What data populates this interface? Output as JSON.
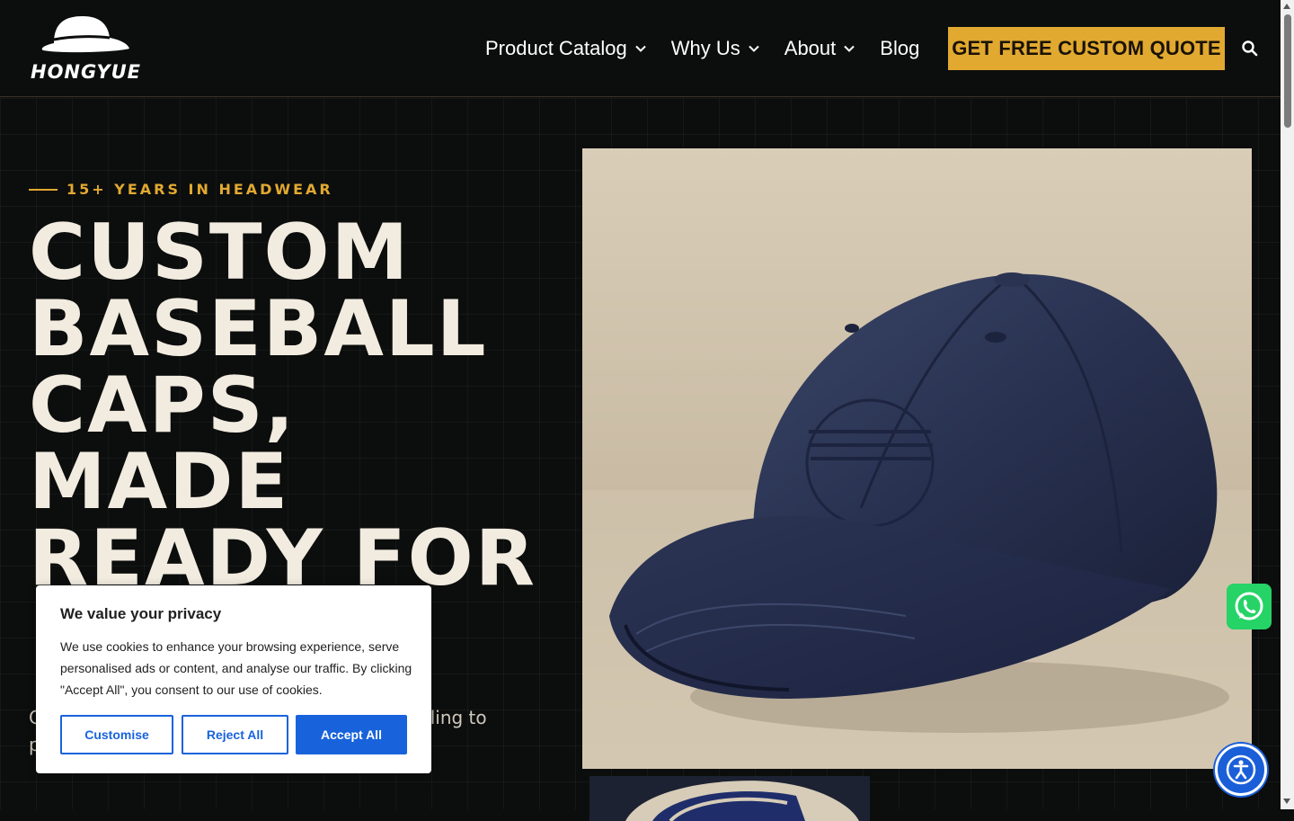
{
  "brand": {
    "name": "HONGYUE"
  },
  "nav": {
    "items": [
      {
        "label": "Product Catalog",
        "has_dropdown": true
      },
      {
        "label": "Why Us",
        "has_dropdown": true
      },
      {
        "label": "About",
        "has_dropdown": true
      },
      {
        "label": "Blog",
        "has_dropdown": false
      }
    ],
    "cta_label": "GET FREE CUSTOM QUOTE",
    "search_icon": "search-icon"
  },
  "hero": {
    "eyebrow": "15+ YEARS IN HEADWEAR",
    "headline_lines": [
      "CUSTOM",
      "BASEBALL",
      "CAPS,",
      "MADE",
      "READY FOR"
    ],
    "lead": "C                                                                , importers, p                                                                  material selection and sampling to production planning.",
    "image_alt_icon": "navy-baseball-cap-image"
  },
  "cookie_banner": {
    "title": "We value your privacy",
    "text": "We use cookies to enhance your browsing experience, serve personalised ads or content, and analyse our traffic. By clicking \"Accept All\", you consent to our use of cookies.",
    "customise_label": "Customise",
    "reject_label": "Reject All",
    "accept_label": "Accept All"
  },
  "colors": {
    "background": "#0c0d0d",
    "accent_gold": "#e1a930",
    "headline": "#f2ece0",
    "cookie_blue": "#1863dc",
    "whatsapp_green": "#25d366"
  }
}
